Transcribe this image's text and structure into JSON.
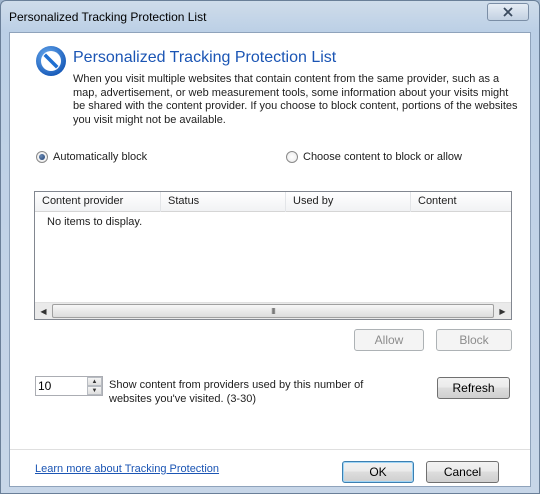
{
  "window": {
    "title": "Personalized Tracking Protection List",
    "close_icon": "close-icon"
  },
  "header": {
    "icon": "block-icon",
    "title": "Personalized Tracking Protection List",
    "description": "When you visit multiple websites that contain content from the same provider, such as a map, advertisement, or web measurement tools, some information about your visits might be shared with the content provider.  If you choose to block content, portions of the websites you visit might not be available."
  },
  "mode": {
    "auto_label": "Automatically block",
    "choose_label": "Choose content to block or allow",
    "selected": "auto"
  },
  "list": {
    "columns": [
      "Content provider",
      "Status",
      "Used by",
      "Content"
    ],
    "empty_text": "No items to display.",
    "scroll_thumb_grip": "III"
  },
  "actions": {
    "allow_label": "Allow",
    "block_label": "Block"
  },
  "threshold": {
    "value": "10",
    "label": "Show content from providers used by this number of websites you've visited. (3-30)",
    "refresh_label": "Refresh"
  },
  "footer": {
    "learn_more": "Learn more about Tracking Protection",
    "ok_label": "OK",
    "cancel_label": "Cancel"
  },
  "colors": {
    "title_blue": "#1b55b4",
    "icon_blue": "#1f6fd1",
    "window_frame": "#bcd0e6"
  }
}
